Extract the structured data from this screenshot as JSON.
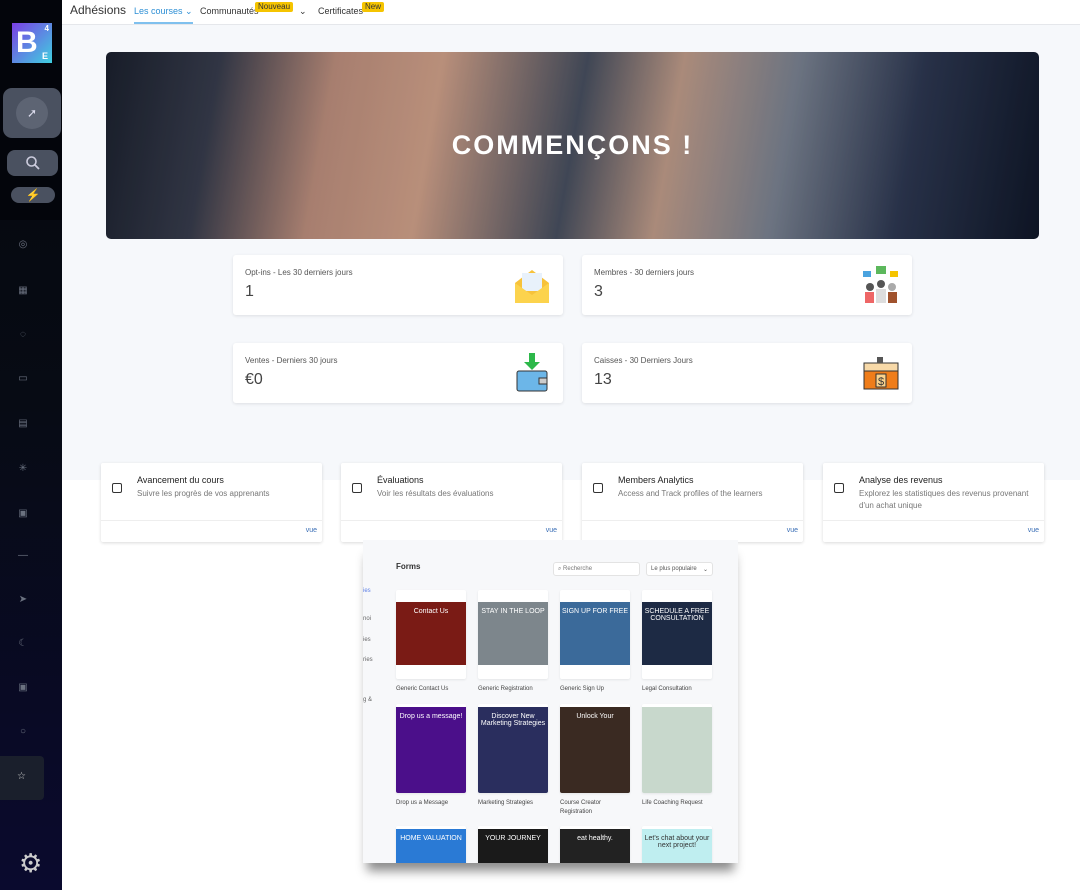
{
  "sidebar": {
    "logo": "B",
    "logo_sup": "4",
    "logo_sub": "E",
    "icons": [
      "pointer-click-icon",
      "search-icon",
      "lightning-icon",
      "dashboard-icon",
      "grid-icon",
      "chat-icon",
      "calendar-icon",
      "contacts-icon",
      "sites-icon",
      "courses-icon",
      "minus-icon",
      "send-icon",
      "reputation-icon",
      "reporting-icon",
      "lightbulb-icon",
      "star-icon",
      "settings-icon"
    ],
    "accent": "#2dd47a"
  },
  "header": {
    "title": "Adhésions",
    "tabs": [
      {
        "label": "Les courses",
        "active": true
      },
      {
        "label": "Communautés",
        "badge": "Nouveau"
      },
      {
        "label": "Certificates",
        "badge": "New"
      }
    ],
    "active_color": "#2d8fd5"
  },
  "hero": {
    "title": "COMMENÇONS !"
  },
  "stats": [
    {
      "label": "Opt-ins - Les 30 derniers jours",
      "value": "1",
      "icon": "envelope-icon"
    },
    {
      "label": "Membres - 30 derniers jours",
      "value": "3",
      "icon": "community-icon"
    },
    {
      "label": "Ventes - Derniers 30 jours",
      "value": "€0",
      "icon": "wallet-icon"
    },
    {
      "label": "Caisses - 30 Derniers Jours",
      "value": "13",
      "icon": "cash-register-icon"
    }
  ],
  "cards": [
    {
      "title": "Avancement du cours",
      "desc": "Suivre les progrès de vos apprenants",
      "link": "vue"
    },
    {
      "title": "Évaluations",
      "desc": "Voir les résultats des évaluations",
      "link": "vue"
    },
    {
      "title": "Members Analytics",
      "desc": "Access and Track profiles of the learners",
      "link": "vue"
    },
    {
      "title": "Analyse des revenus",
      "desc": "Explorez les statistiques des revenus provenant d'un achat unique",
      "link": "vue"
    }
  ],
  "forms": {
    "title": "Forms",
    "search_placeholder": "Recherche",
    "sort": "Le plus populaire",
    "side": [
      "ies",
      "noi",
      "ies",
      "ries",
      "g &"
    ],
    "templates": [
      {
        "name": "Generic Contact Us",
        "heading": "Contact Us",
        "color": "#7a1b15"
      },
      {
        "name": "Generic Registration",
        "heading": "STAY IN THE LOOP",
        "color": "#7d868c"
      },
      {
        "name": "Generic Sign Up",
        "heading": "SIGN UP FOR FREE",
        "color": "#3b6a9a"
      },
      {
        "name": "Legal Consultation",
        "heading": "SCHEDULE A FREE CONSULTATION",
        "color": "#1d2a44"
      },
      {
        "name": "Drop us a Message",
        "heading": "Drop us a message!",
        "color": "#4b0f8a"
      },
      {
        "name": "Marketing Strategies",
        "heading": "Discover New Marketing Strategies",
        "color": "#2a2e5e"
      },
      {
        "name": "Course Creator Registration",
        "heading": "Unlock Your",
        "color": "#3a2a22"
      },
      {
        "name": "Life Coaching Request",
        "heading": "",
        "color": "#c8d8cc"
      },
      {
        "name": "",
        "heading": "HOME VALUATION",
        "color": "#2a7ad5"
      },
      {
        "name": "",
        "heading": "YOUR JOURNEY",
        "color": "#1a1a1a"
      },
      {
        "name": "",
        "heading": "eat healthy.",
        "color": "#222"
      },
      {
        "name": "",
        "heading": "Let's chat about your next project!",
        "color": "#bfeef0"
      }
    ]
  }
}
